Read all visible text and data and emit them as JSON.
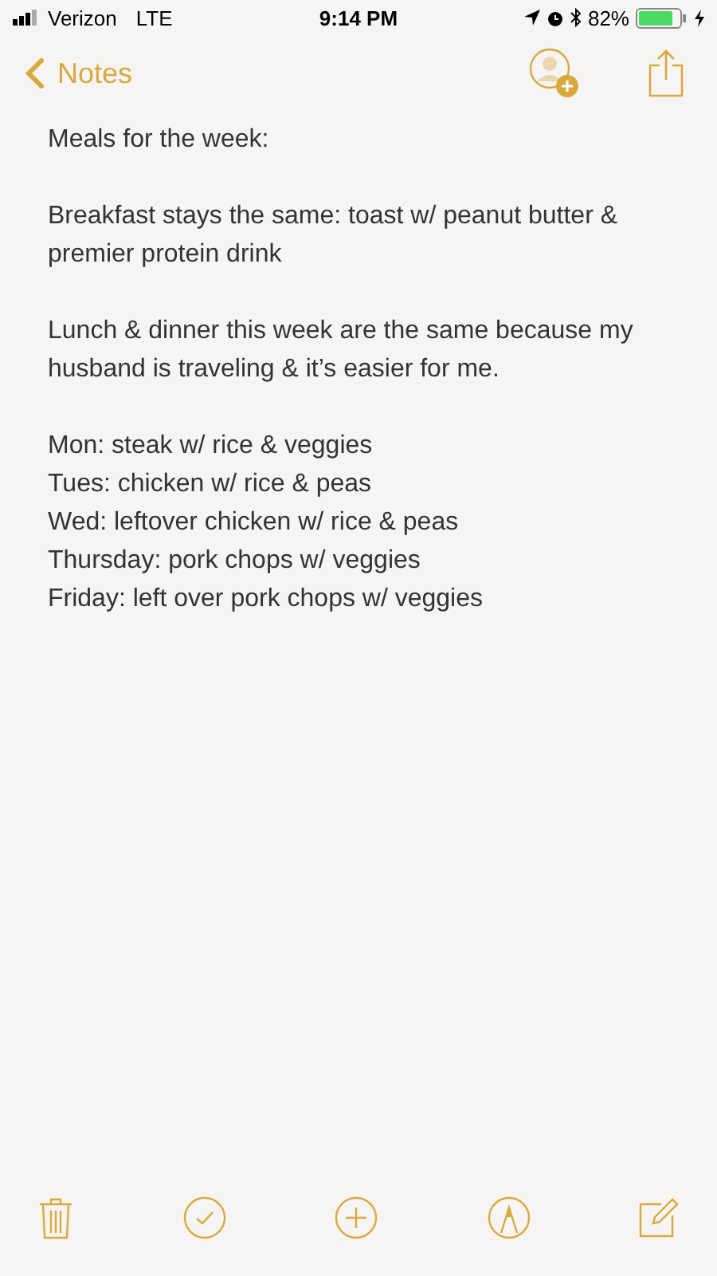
{
  "status_bar": {
    "carrier": "Verizon",
    "network": "LTE",
    "time": "9:14 PM",
    "battery": "82%"
  },
  "nav": {
    "back_label": "Notes"
  },
  "note": {
    "paragraphs": [
      {
        "lines": [
          "Meals for the week:"
        ]
      },
      {
        "lines": [
          "Breakfast stays the same: toast w/ peanut butter & premier protein drink"
        ]
      },
      {
        "lines": [
          "Lunch & dinner this week are the same because my husband is traveling & it’s easier for me."
        ]
      },
      {
        "lines": [
          "Mon: steak w/ rice & veggies",
          "Tues: chicken w/ rice & peas",
          "Wed: leftover chicken w/ rice & peas",
          "Thursday: pork chops w/ veggies",
          "Friday: left over pork chops w/ veggies"
        ]
      }
    ]
  },
  "toolbar": [
    {
      "kind": "trash"
    },
    {
      "kind": "check"
    },
    {
      "kind": "plus"
    },
    {
      "kind": "pen"
    },
    {
      "kind": "compose"
    }
  ]
}
